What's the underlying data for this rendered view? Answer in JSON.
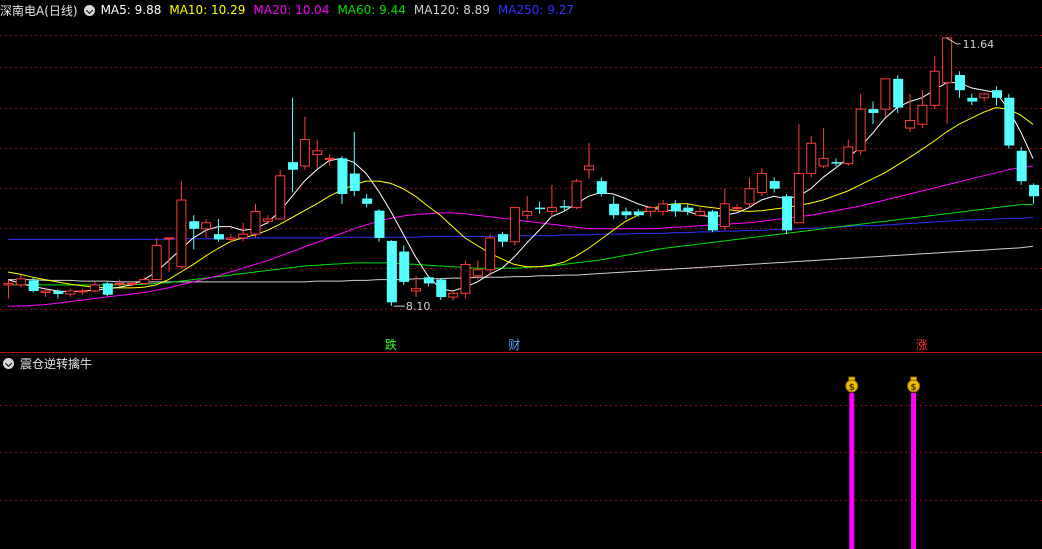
{
  "header": {
    "title": "深南电A(日线)",
    "ma": [
      {
        "label": "MA5: 9.88",
        "color": "#ffffff"
      },
      {
        "label": "MA10: 10.29",
        "color": "#ffff00"
      },
      {
        "label": "MA20: 10.04",
        "color": "#ff00ff"
      },
      {
        "label": "MA60: 9.44",
        "color": "#00e000"
      },
      {
        "label": "MA120: 8.89",
        "color": "#d0d0d0"
      },
      {
        "label": "MA250: 9.27",
        "color": "#3030ff"
      }
    ]
  },
  "indicator": {
    "title": "震仓逆转擒牛"
  },
  "colors": {
    "up": "#ff3c3c",
    "down": "#54ffff",
    "grid": "#8a1010",
    "divider": "#b01818"
  },
  "chart_data": {
    "type": "candlestick",
    "y_range": [
      7.6,
      11.85
    ],
    "max_label": "11.64",
    "min_label": "8.10",
    "max_value": 11.64,
    "min_value": 8.1,
    "candles": [
      [
        8.38,
        8.4,
        8.2,
        8.45
      ],
      [
        8.38,
        8.46,
        8.35,
        8.52
      ],
      [
        8.44,
        8.3,
        8.28,
        8.47
      ],
      [
        8.28,
        8.3,
        8.22,
        8.33
      ],
      [
        8.3,
        8.26,
        8.2,
        8.32
      ],
      [
        8.26,
        8.3,
        8.22,
        8.33
      ],
      [
        8.3,
        8.3,
        8.25,
        8.33
      ],
      [
        8.3,
        8.38,
        8.28,
        8.42
      ],
      [
        8.4,
        8.25,
        8.23,
        8.42
      ],
      [
        8.4,
        8.4,
        8.35,
        8.45
      ],
      [
        8.4,
        8.4,
        8.36,
        8.43
      ],
      [
        8.4,
        8.45,
        8.38,
        8.48
      ],
      [
        8.45,
        8.9,
        8.45,
        9.0
      ],
      [
        9.0,
        9.0,
        8.55,
        9.0
      ],
      [
        8.62,
        9.5,
        8.6,
        9.75
      ],
      [
        9.22,
        9.12,
        8.85,
        9.3
      ],
      [
        9.12,
        9.2,
        9.0,
        9.25
      ],
      [
        9.05,
        8.98,
        8.95,
        9.25
      ],
      [
        8.98,
        9.0,
        8.95,
        9.05
      ],
      [
        9.0,
        9.05,
        8.95,
        9.2
      ],
      [
        9.05,
        9.35,
        9.0,
        9.45
      ],
      [
        9.22,
        9.25,
        9.18,
        9.3
      ],
      [
        9.25,
        9.82,
        9.25,
        9.9
      ],
      [
        10.0,
        9.9,
        9.6,
        10.85
      ],
      [
        9.95,
        10.3,
        9.9,
        10.6
      ],
      [
        10.1,
        10.15,
        9.92,
        10.3
      ],
      [
        10.05,
        10.05,
        9.95,
        10.1
      ],
      [
        10.05,
        9.58,
        9.45,
        10.08
      ],
      [
        9.85,
        9.62,
        9.55,
        10.4
      ],
      [
        9.52,
        9.45,
        9.4,
        9.58
      ],
      [
        9.36,
        9.0,
        8.95,
        9.38
      ],
      [
        8.96,
        8.15,
        8.1,
        8.97
      ],
      [
        8.82,
        8.42,
        8.38,
        8.9
      ],
      [
        8.3,
        8.33,
        8.22,
        8.5
      ],
      [
        8.48,
        8.4,
        8.36,
        8.5
      ],
      [
        8.45,
        8.22,
        8.18,
        8.47
      ],
      [
        8.22,
        8.27,
        8.18,
        8.3
      ],
      [
        8.27,
        8.65,
        8.2,
        8.7
      ],
      [
        8.5,
        8.58,
        8.45,
        8.7
      ],
      [
        8.58,
        9.0,
        8.5,
        9.05
      ],
      [
        9.05,
        8.95,
        8.88,
        9.08
      ],
      [
        8.95,
        9.4,
        8.9,
        9.4
      ],
      [
        9.3,
        9.35,
        9.25,
        9.55
      ],
      [
        9.4,
        9.38,
        9.32,
        9.48
      ],
      [
        9.35,
        9.4,
        9.28,
        9.7
      ],
      [
        9.42,
        9.4,
        9.35,
        9.5
      ],
      [
        9.4,
        9.75,
        9.38,
        9.78
      ],
      [
        9.9,
        9.95,
        9.78,
        10.25
      ],
      [
        9.75,
        9.58,
        9.55,
        9.8
      ],
      [
        9.45,
        9.3,
        9.25,
        9.55
      ],
      [
        9.35,
        9.3,
        9.25,
        9.4
      ],
      [
        9.35,
        9.3,
        9.28,
        9.38
      ],
      [
        9.35,
        9.4,
        9.28,
        9.42
      ],
      [
        9.35,
        9.45,
        9.3,
        9.5
      ],
      [
        9.45,
        9.35,
        9.28,
        9.5
      ],
      [
        9.4,
        9.35,
        9.3,
        9.45
      ],
      [
        9.3,
        9.35,
        9.28,
        9.4
      ],
      [
        9.35,
        9.1,
        9.08,
        9.37
      ],
      [
        9.15,
        9.45,
        9.1,
        9.65
      ],
      [
        9.4,
        9.4,
        9.35,
        9.45
      ],
      [
        9.45,
        9.65,
        9.4,
        9.8
      ],
      [
        9.6,
        9.85,
        9.55,
        9.92
      ],
      [
        9.75,
        9.65,
        9.6,
        9.8
      ],
      [
        9.55,
        9.1,
        9.05,
        9.58
      ],
      [
        9.2,
        9.85,
        9.2,
        10.5
      ],
      [
        9.85,
        10.25,
        9.8,
        10.35
      ],
      [
        9.95,
        10.05,
        9.92,
        10.45
      ],
      [
        10.0,
        9.98,
        9.95,
        10.05
      ],
      [
        9.98,
        10.2,
        9.95,
        10.3
      ],
      [
        10.15,
        10.7,
        10.1,
        10.9
      ],
      [
        10.7,
        10.65,
        10.5,
        10.8
      ],
      [
        10.7,
        11.1,
        10.6,
        11.1
      ],
      [
        11.1,
        10.72,
        10.65,
        11.15
      ],
      [
        10.45,
        10.55,
        10.4,
        10.9
      ],
      [
        10.5,
        10.75,
        10.45,
        10.95
      ],
      [
        10.75,
        11.2,
        10.7,
        11.4
      ],
      [
        11.05,
        11.64,
        10.5,
        11.64
      ],
      [
        11.15,
        10.95,
        10.85,
        11.2
      ],
      [
        10.85,
        10.8,
        10.75,
        10.9
      ],
      [
        10.85,
        10.9,
        10.8,
        10.92
      ],
      [
        10.95,
        10.85,
        10.75,
        11.0
      ],
      [
        10.85,
        10.22,
        10.18,
        10.9
      ],
      [
        10.15,
        9.75,
        9.7,
        10.2
      ],
      [
        9.7,
        9.55,
        9.45,
        9.72
      ]
    ],
    "ma5": [
      8.45,
      8.4,
      8.36,
      8.33,
      8.3,
      8.29,
      8.3,
      8.31,
      8.33,
      8.35,
      8.38,
      8.45,
      8.55,
      8.7,
      8.85,
      9.0,
      9.1,
      9.15,
      9.15,
      9.1,
      9.12,
      9.2,
      9.35,
      9.55,
      9.75,
      9.9,
      10.02,
      10.05,
      10.0,
      9.85,
      9.62,
      9.35,
      9.05,
      8.75,
      8.5,
      8.33,
      8.3,
      8.35,
      8.42,
      8.52,
      8.6,
      8.75,
      8.93,
      9.1,
      9.28,
      9.35,
      9.45,
      9.55,
      9.6,
      9.58,
      9.52,
      9.45,
      9.4,
      9.37,
      9.36,
      9.35,
      9.3,
      9.28,
      9.3,
      9.33,
      9.4,
      9.5,
      9.55,
      9.52,
      9.55,
      9.65,
      9.8,
      9.92,
      10.05,
      10.2,
      10.38,
      10.58,
      10.72,
      10.8,
      10.85,
      10.95,
      11.05,
      11.05,
      10.98,
      10.95,
      10.92,
      10.7,
      10.4,
      10.05
    ],
    "ma10": [
      8.55,
      8.52,
      8.48,
      8.45,
      8.42,
      8.39,
      8.37,
      8.35,
      8.34,
      8.34,
      8.34,
      8.35,
      8.38,
      8.45,
      8.55,
      8.65,
      8.76,
      8.86,
      8.95,
      9.0,
      9.04,
      9.1,
      9.18,
      9.27,
      9.36,
      9.45,
      9.55,
      9.63,
      9.7,
      9.75,
      9.75,
      9.72,
      9.65,
      9.55,
      9.42,
      9.3,
      9.15,
      9.0,
      8.9,
      8.8,
      8.72,
      8.65,
      8.62,
      8.62,
      8.64,
      8.68,
      8.76,
      8.86,
      8.98,
      9.1,
      9.22,
      9.3,
      9.38,
      9.43,
      9.45,
      9.45,
      9.42,
      9.4,
      9.38,
      9.36,
      9.35,
      9.36,
      9.38,
      9.4,
      9.43,
      9.46,
      9.5,
      9.56,
      9.62,
      9.7,
      9.78,
      9.86,
      9.96,
      10.06,
      10.17,
      10.28,
      10.4,
      10.5,
      10.58,
      10.66,
      10.72,
      10.7,
      10.62,
      10.5
    ],
    "ma20": [
      8.1,
      8.1,
      8.11,
      8.12,
      8.14,
      8.16,
      8.18,
      8.2,
      8.22,
      8.24,
      8.26,
      8.28,
      8.31,
      8.34,
      8.38,
      8.42,
      8.46,
      8.5,
      8.55,
      8.6,
      8.65,
      8.7,
      8.76,
      8.82,
      8.88,
      8.94,
      9.0,
      9.06,
      9.12,
      9.17,
      9.22,
      9.26,
      9.29,
      9.31,
      9.32,
      9.33,
      9.33,
      9.32,
      9.3,
      9.28,
      9.26,
      9.24,
      9.22,
      9.2,
      9.18,
      9.16,
      9.14,
      9.12,
      9.12,
      9.12,
      9.12,
      9.12,
      9.12,
      9.13,
      9.14,
      9.15,
      9.16,
      9.17,
      9.18,
      9.19,
      9.2,
      9.22,
      9.24,
      9.26,
      9.28,
      9.3,
      9.33,
      9.36,
      9.39,
      9.42,
      9.46,
      9.5,
      9.54,
      9.58,
      9.62,
      9.66,
      9.7,
      9.74,
      9.78,
      9.82,
      9.86,
      9.9,
      9.93,
      9.95
    ],
    "ma60": [
      8.38,
      8.38,
      8.38,
      8.38,
      8.38,
      8.38,
      8.38,
      8.38,
      8.38,
      8.38,
      8.38,
      8.39,
      8.4,
      8.41,
      8.43,
      8.45,
      8.47,
      8.49,
      8.51,
      8.53,
      8.55,
      8.57,
      8.59,
      8.61,
      8.63,
      8.64,
      8.65,
      8.66,
      8.67,
      8.67,
      8.67,
      8.67,
      8.66,
      8.65,
      8.64,
      8.63,
      8.62,
      8.61,
      8.6,
      8.6,
      8.6,
      8.6,
      8.61,
      8.62,
      8.63,
      8.65,
      8.67,
      8.69,
      8.71,
      8.74,
      8.77,
      8.8,
      8.83,
      8.86,
      8.88,
      8.9,
      8.92,
      8.94,
      8.96,
      8.98,
      9.0,
      9.02,
      9.04,
      9.06,
      9.08,
      9.1,
      9.12,
      9.14,
      9.16,
      9.18,
      9.2,
      9.22,
      9.24,
      9.26,
      9.28,
      9.3,
      9.32,
      9.34,
      9.36,
      9.38,
      9.4,
      9.42,
      9.44,
      9.44
    ],
    "ma120": [
      8.45,
      8.45,
      8.45,
      8.44,
      8.44,
      8.44,
      8.43,
      8.43,
      8.43,
      8.42,
      8.42,
      8.42,
      8.42,
      8.42,
      8.42,
      8.42,
      8.42,
      8.42,
      8.42,
      8.42,
      8.42,
      8.42,
      8.42,
      8.42,
      8.42,
      8.43,
      8.43,
      8.43,
      8.44,
      8.44,
      8.45,
      8.45,
      8.45,
      8.46,
      8.46,
      8.46,
      8.47,
      8.47,
      8.48,
      8.48,
      8.48,
      8.49,
      8.49,
      8.5,
      8.5,
      8.51,
      8.51,
      8.52,
      8.53,
      8.54,
      8.55,
      8.56,
      8.57,
      8.58,
      8.59,
      8.6,
      8.61,
      8.62,
      8.63,
      8.64,
      8.65,
      8.66,
      8.67,
      8.68,
      8.69,
      8.7,
      8.71,
      8.72,
      8.73,
      8.74,
      8.75,
      8.76,
      8.77,
      8.78,
      8.79,
      8.8,
      8.81,
      8.82,
      8.83,
      8.84,
      8.85,
      8.86,
      8.87,
      8.89
    ],
    "ma250": [
      8.98,
      8.98,
      8.98,
      8.98,
      8.98,
      8.98,
      8.98,
      8.98,
      8.98,
      8.98,
      8.98,
      8.98,
      8.98,
      8.98,
      8.99,
      8.99,
      8.99,
      8.99,
      8.99,
      8.99,
      9.0,
      9.0,
      9.0,
      9.0,
      9.0,
      9.0,
      9.0,
      9.01,
      9.01,
      9.01,
      9.01,
      9.01,
      9.01,
      9.01,
      9.02,
      9.02,
      9.02,
      9.02,
      9.02,
      9.02,
      9.03,
      9.03,
      9.03,
      9.03,
      9.03,
      9.04,
      9.04,
      9.04,
      9.05,
      9.05,
      9.05,
      9.06,
      9.06,
      9.06,
      9.07,
      9.07,
      9.08,
      9.08,
      9.09,
      9.09,
      9.1,
      9.1,
      9.11,
      9.11,
      9.12,
      9.13,
      9.13,
      9.14,
      9.15,
      9.16,
      9.16,
      9.17,
      9.18,
      9.19,
      9.2,
      9.21,
      9.22,
      9.23,
      9.24,
      9.24,
      9.25,
      9.26,
      9.26,
      9.27
    ],
    "markers": [
      {
        "label": "跌",
        "index": 31,
        "color": "#33ff33"
      },
      {
        "label": "财",
        "index": 41,
        "color": "#5aa0ff"
      },
      {
        "label": "涨",
        "index": 74,
        "color": "#ff3333"
      }
    ],
    "signals": [
      {
        "index": 68,
        "icon": "money-bag-icon"
      },
      {
        "index": 73,
        "icon": "money-bag-icon"
      }
    ]
  }
}
